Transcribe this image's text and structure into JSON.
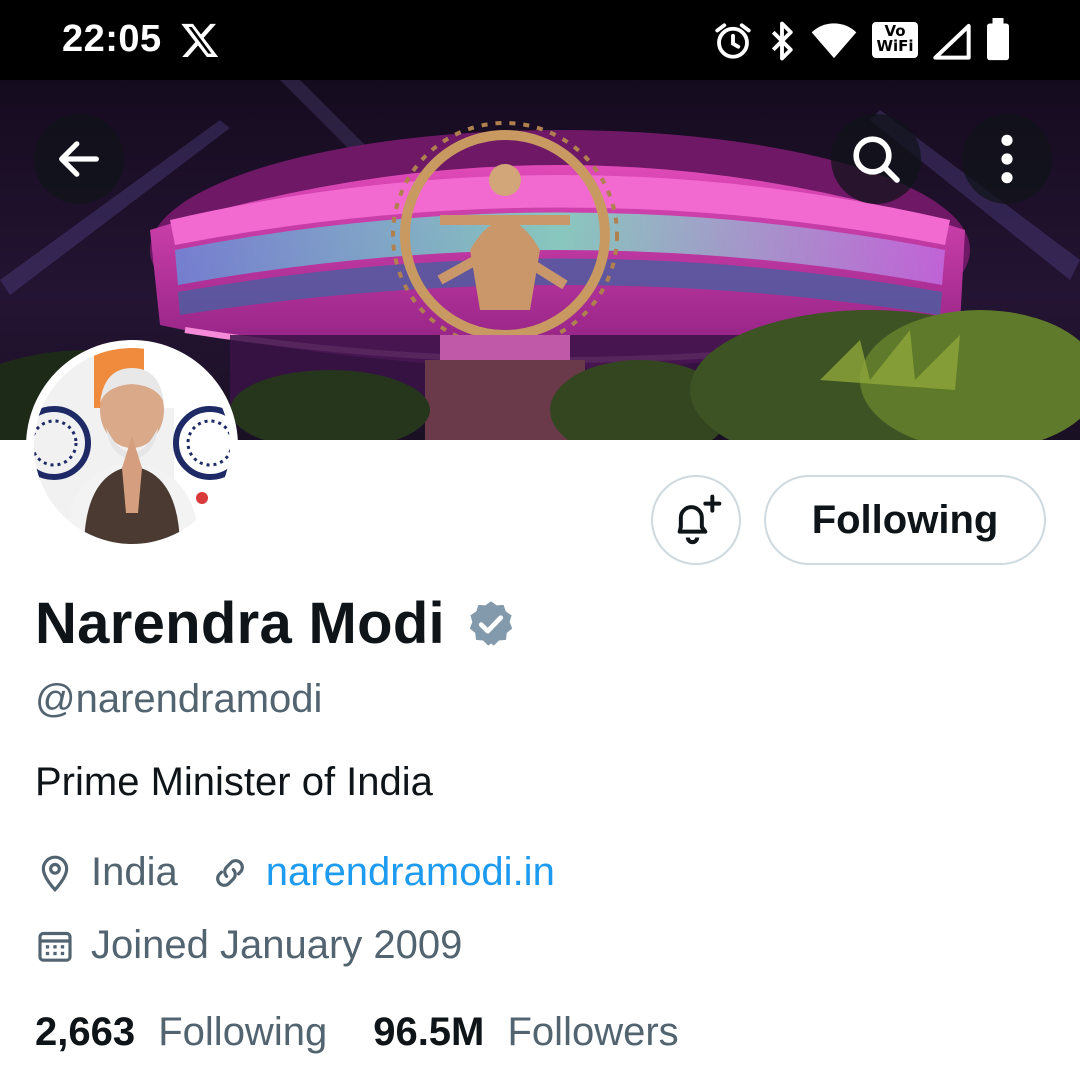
{
  "status_bar": {
    "time": "22:05",
    "app_icon": "x-logo-icon",
    "icons": [
      "alarm-icon",
      "bluetooth-icon",
      "wifi-icon",
      "vowifi-icon",
      "signal-icon",
      "battery-icon"
    ],
    "vowifi_line1": "Vo",
    "vowifi_line2": "WiFi"
  },
  "header": {
    "back_icon": "arrow-left-icon",
    "search_icon": "search-icon",
    "more_icon": "more-vertical-icon"
  },
  "profile": {
    "display_name": "Narendra Modi",
    "handle": "@narendramodi",
    "bio": "Prime Minister of India",
    "location": "India",
    "website": "narendramodi.in",
    "joined": "Joined January 2009",
    "following_count": "2,663",
    "following_label": "Following",
    "followers_count": "96.5M",
    "followers_label": "Followers"
  },
  "actions": {
    "notify_icon": "bell-plus-icon",
    "follow_state_label": "Following"
  },
  "colors": {
    "text_primary": "#0f1419",
    "text_secondary": "#536471",
    "link": "#1d9bf0",
    "verified_gray": "#829aab",
    "border": "#cfd9de"
  }
}
